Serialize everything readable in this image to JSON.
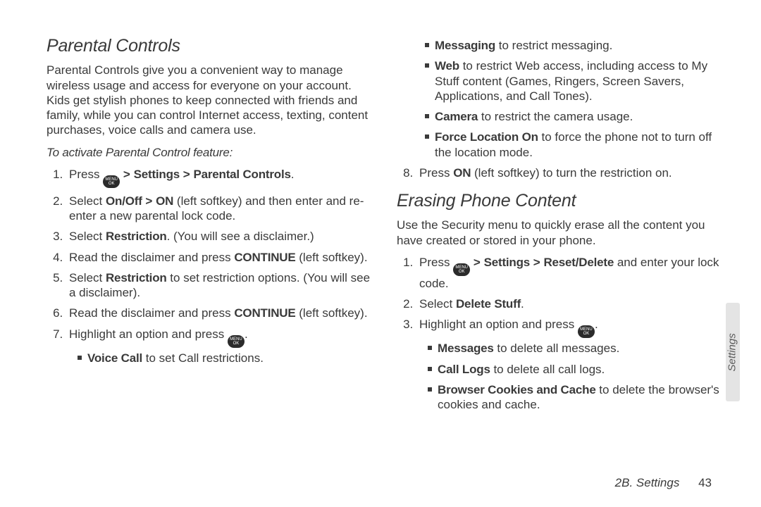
{
  "key": {
    "line1": "MENU",
    "line2": "OK"
  },
  "sep": ">",
  "left": {
    "heading": "Parental Controls",
    "intro": "Parental Controls give you a convenient way to manage wireless usage and access for everyone on your account. Kids get stylish phones to keep connected with friends and family, while you can control Internet access, texting, content purchases, voice calls and camera use.",
    "lead": "To activate Parental Control feature:",
    "steps": {
      "s1": {
        "pre": "Press ",
        "b1": "Settings",
        "b2": "Parental Controls",
        "post": "."
      },
      "s2": {
        "pre": "Select ",
        "b": "On/Off",
        "mid": " ",
        "b2": "ON",
        "post": " (left softkey) and then enter and re-enter a new parental lock code."
      },
      "s3": {
        "pre": "Select ",
        "b": "Restriction",
        "post": ". (You will see a disclaimer.)"
      },
      "s4": {
        "pre": "Read the disclaimer and press ",
        "b": "CONTINUE",
        "post": " (left softkey)."
      },
      "s5": {
        "pre": "Select ",
        "b": "Restriction",
        "post": " to set restriction options. (You will see a disclaimer)."
      },
      "s6": {
        "pre": "Read the disclaimer and press ",
        "b": "CONTINUE",
        "post": " (left softkey)."
      },
      "s7": {
        "pre": "Highlight an option and press ",
        "post": "."
      },
      "sub": {
        "voice": {
          "b": "Voice Call",
          "post": " to set Call restrictions."
        }
      }
    }
  },
  "right": {
    "sub_top": {
      "messaging": {
        "b": "Messaging",
        "post": " to restrict messaging."
      },
      "web": {
        "b": "Web",
        "post": " to restrict Web access, including access to My Stuff content (Games, Ringers, Screen Savers, Applications, and Call Tones)."
      },
      "camera": {
        "b": "Camera",
        "post": " to restrict the camera usage."
      },
      "force": {
        "b": "Force Location On",
        "post": " to force the phone not to turn off the location mode."
      }
    },
    "step8": {
      "pre": "Press ",
      "b": "ON",
      "post": " (left softkey) to turn the restriction on."
    },
    "heading2": "Erasing Phone Content",
    "intro2": "Use the Security menu to quickly erase all the content you have created or stored in your phone.",
    "steps2": {
      "s1": {
        "pre": "Press ",
        "b1": "Settings",
        "b2": "Reset/Delete",
        "post": " and enter your lock code."
      },
      "s2": {
        "pre": "Select ",
        "b": "Delete Stuff",
        "post": "."
      },
      "s3": {
        "pre": "Highlight an option and press ",
        "post": "."
      },
      "sub": {
        "messages": {
          "b": "Messages",
          "post": " to delete all messages."
        },
        "calllogs": {
          "b": "Call Logs",
          "post": " to delete all call logs."
        },
        "cookies": {
          "b": "Browser Cookies and Cache",
          "post": " to delete the browser's cookies and cache."
        }
      }
    }
  },
  "sidetab": "Settings",
  "footer": {
    "section": "2B. Settings",
    "page": "43"
  }
}
